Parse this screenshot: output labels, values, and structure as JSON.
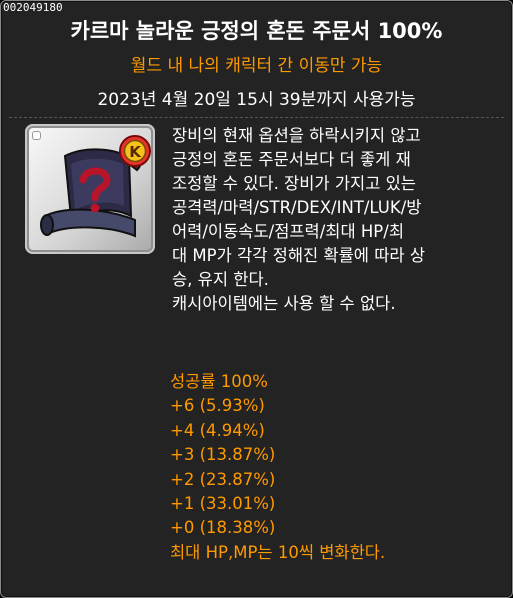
{
  "item": {
    "id": "002049180",
    "name": "카르마 놀라운 긍정의 혼돈 주문서 100%",
    "restriction": "월드 내 나의 캐릭터 간 이동만 가능",
    "expiry": "2023년 4월 20일 15시 39분까지 사용가능",
    "icon": "chaos-scroll-icon",
    "badge_letter": "K"
  },
  "description": {
    "lines": [
      "장비의 현재 옵션을 하락시키지 않고",
      "긍정의 혼돈 주문서보다 더 좋게 재",
      "조정할 수 있다. 장비가 가지고 있는",
      "공격력/마력/STR/DEX/INT/LUK/방",
      "어력/이동속도/점프력/최대 HP/최",
      "대 MP가 각각 정해진 확률에 따라 상",
      "승, 유지 한다.",
      "캐시아이템에는 사용 할 수 없다."
    ]
  },
  "stats": {
    "success_rate": "성공률 100%",
    "chances": [
      "+6 (5.93%)",
      "+4 (4.94%)",
      "+3 (13.87%)",
      "+2 (23.87%)",
      "+1 (33.01%)",
      "+0 (18.38%)"
    ],
    "note": "최대 HP,MP는 10씩 변화한다."
  },
  "colors": {
    "background": "#232323",
    "title": "#ffffff",
    "accent": "#ff9900",
    "text": "#ffffff"
  }
}
